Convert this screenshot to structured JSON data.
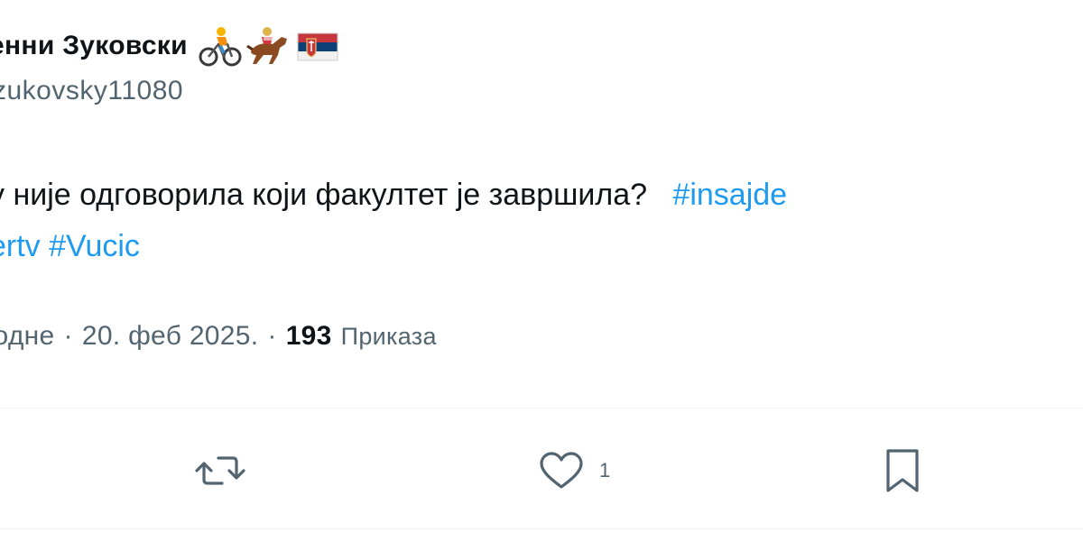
{
  "author": {
    "display_name": "енни Зуковски",
    "handle": "zukovsky11080",
    "emojis": [
      "cyclist-emoji",
      "horse-racing-emoji",
      "serbia-flag-emoji"
    ]
  },
  "tweet": {
    "line1_text": "у није одговорила који факултет је завршила?",
    "line1_hashtag": "#insajde",
    "line2_hashtag1": "ertv",
    "line2_hashtag2": "#Vucic"
  },
  "meta": {
    "time": "подне",
    "separator": "·",
    "date": "20. феб 2025.",
    "views_count": "193",
    "views_label": "Приказа"
  },
  "actions": {
    "like_count": "1"
  },
  "colors": {
    "text": "#0f1419",
    "secondary": "#536471",
    "link": "#1d9bf0",
    "divider": "#eff3f4"
  }
}
